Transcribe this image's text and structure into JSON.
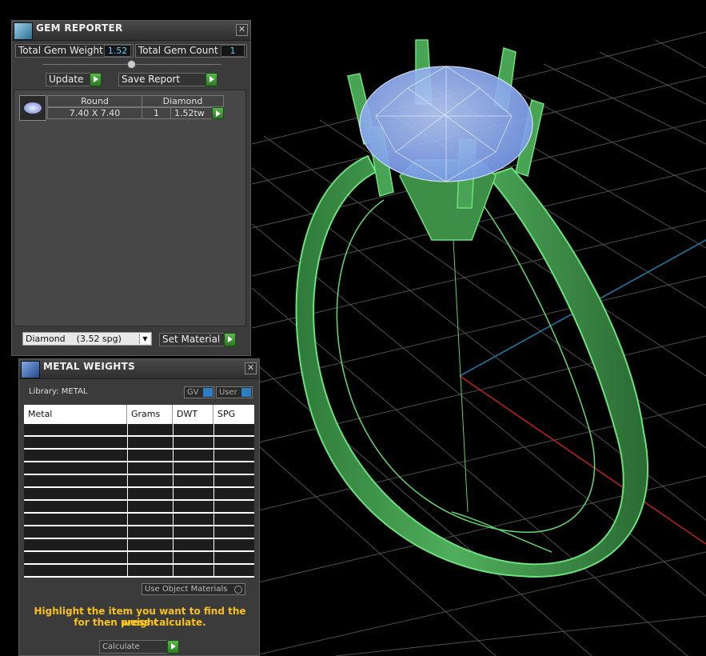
{
  "gem_reporter": {
    "title": "GEM REPORTER",
    "close_glyph": "✕",
    "total_weight_label": "Total Gem Weight",
    "total_weight_value": "1.52",
    "total_count_label": "Total Gem Count",
    "total_count_value": "1",
    "update_label": "Update",
    "save_report_label": "Save Report",
    "table": {
      "headers": [
        "Round",
        "Diamond"
      ],
      "row": {
        "size": "7.40 X 7.40",
        "count": "1",
        "weight": "1.52tw"
      }
    },
    "material_select": "Diamond    (3.52 spg)",
    "set_material_label": "Set Material"
  },
  "metal_weights": {
    "title": "METAL WEIGHTS",
    "close_glyph": "✕",
    "library_label": "Library: METAL",
    "toggle_gv": "GV",
    "toggle_user": "User",
    "columns": [
      "Metal",
      "Grams",
      "DWT",
      "SPG"
    ],
    "use_object_materials_label": "Use Object Materials",
    "instruction_line1": "Highlight the item you want to find the weight",
    "instruction_line2": "for then press calculate.",
    "calculate_label": "Calculate"
  },
  "icons": {
    "gem_logo": "gem-reporter-logo-icon",
    "metal_logo": "metal-weights-logo-icon",
    "close": "close-icon",
    "play": "play-arrow-icon"
  },
  "colors": {
    "ring_green": "#3f9a4c",
    "gem_blue": "#8fb0f5",
    "value_cyan": "#5ecbff",
    "instruction_yellow": "#f7c21b",
    "axis_red": "#c02020",
    "axis_blue": "#1f7fa8"
  }
}
